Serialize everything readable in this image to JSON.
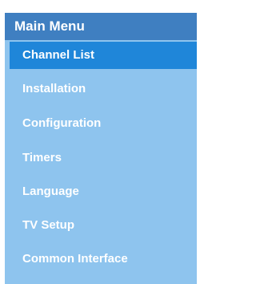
{
  "menu": {
    "title": "Main Menu",
    "selected_index": 0,
    "items": [
      {
        "label": "Channel List"
      },
      {
        "label": "Installation"
      },
      {
        "label": "Configuration"
      },
      {
        "label": "Timers"
      },
      {
        "label": "Language"
      },
      {
        "label": "TV Setup"
      },
      {
        "label": "Common Interface"
      }
    ]
  },
  "colors": {
    "header_bg": "#3f7fc1",
    "body_bg": "#8ec4ee",
    "selected_bg": "#1f86d9",
    "text": "#ffffff"
  }
}
